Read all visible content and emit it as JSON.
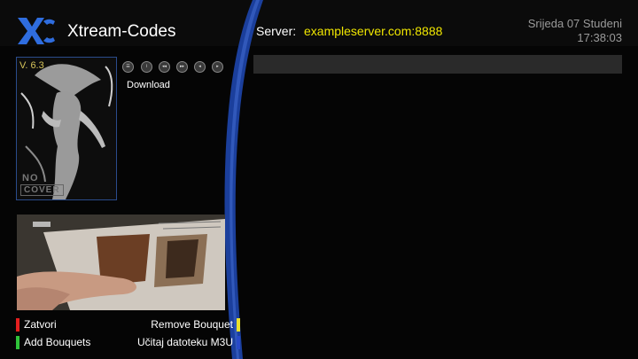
{
  "header": {
    "app_title": "Xtream-Codes",
    "server_label": "Server:",
    "server_value": "exampleserver.com:8888",
    "date": "Srijeda 07 Studeni",
    "time": "17:38:03"
  },
  "cover": {
    "version": "V. 6.3",
    "no_label": "NO",
    "cover_label": "COVER"
  },
  "controls": {
    "icons": [
      "menu-icon",
      "info-icon",
      "rewind-icon",
      "next-icon",
      "back-icon",
      "fast-forward-icon"
    ],
    "download_label": "Download"
  },
  "legend": {
    "red_label": "Zatvori",
    "green_label": "Add Bouquets",
    "yellow_label": "Remove Bouquet",
    "blue_label": "Učitaj datoteku M3U"
  },
  "colors": {
    "red": "#e41e1e",
    "green": "#2fc33a",
    "yellow": "#ece22a",
    "blue": "#2849c8",
    "server_value": "#f0e600",
    "accent_stripe": "#1b3f9c"
  }
}
